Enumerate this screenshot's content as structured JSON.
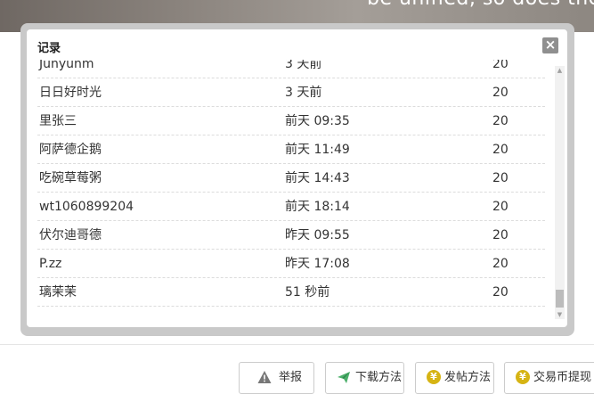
{
  "banner": {
    "text": "be unified, so does the expe"
  },
  "dialog": {
    "title": "记录",
    "close_glyph": "×",
    "rows": [
      {
        "name": "Junyunm",
        "time": "3 天前",
        "amount": "20"
      },
      {
        "name": "日日好时光",
        "time": "3 天前",
        "amount": "20"
      },
      {
        "name": "里张三",
        "time": "前天 09:35",
        "amount": "20"
      },
      {
        "name": "阿萨德企鹅",
        "time": "前天 11:49",
        "amount": "20"
      },
      {
        "name": "吃碗草莓粥",
        "time": "前天 14:43",
        "amount": "20"
      },
      {
        "name": "wt1060899204",
        "time": "前天 18:14",
        "amount": "20"
      },
      {
        "name": "伏尔迪哥德",
        "time": "昨天 09:55",
        "amount": "20"
      },
      {
        "name": "P.zz",
        "time": "昨天 17:08",
        "amount": "20"
      },
      {
        "name": "璃茉茉",
        "time": "51 秒前",
        "amount": "20"
      }
    ]
  },
  "scrollbar": {
    "up_glyph": "▲",
    "down_glyph": "▼",
    "scroll_position": 0.95
  },
  "actions": {
    "report": {
      "label": "举报",
      "icon": "warning-icon"
    },
    "download": {
      "label": "下载方法",
      "icon": "paper-plane-icon"
    },
    "post": {
      "label": "发帖方法",
      "icon": "coin-icon"
    },
    "withdraw": {
      "label": "交易币提现",
      "icon": "coin-icon"
    },
    "coin_glyph": "¥"
  },
  "colors": {
    "coin": "#d6b414",
    "plane": "#4caf6a",
    "warning": "#777777",
    "frame": "#c9c9c9"
  }
}
